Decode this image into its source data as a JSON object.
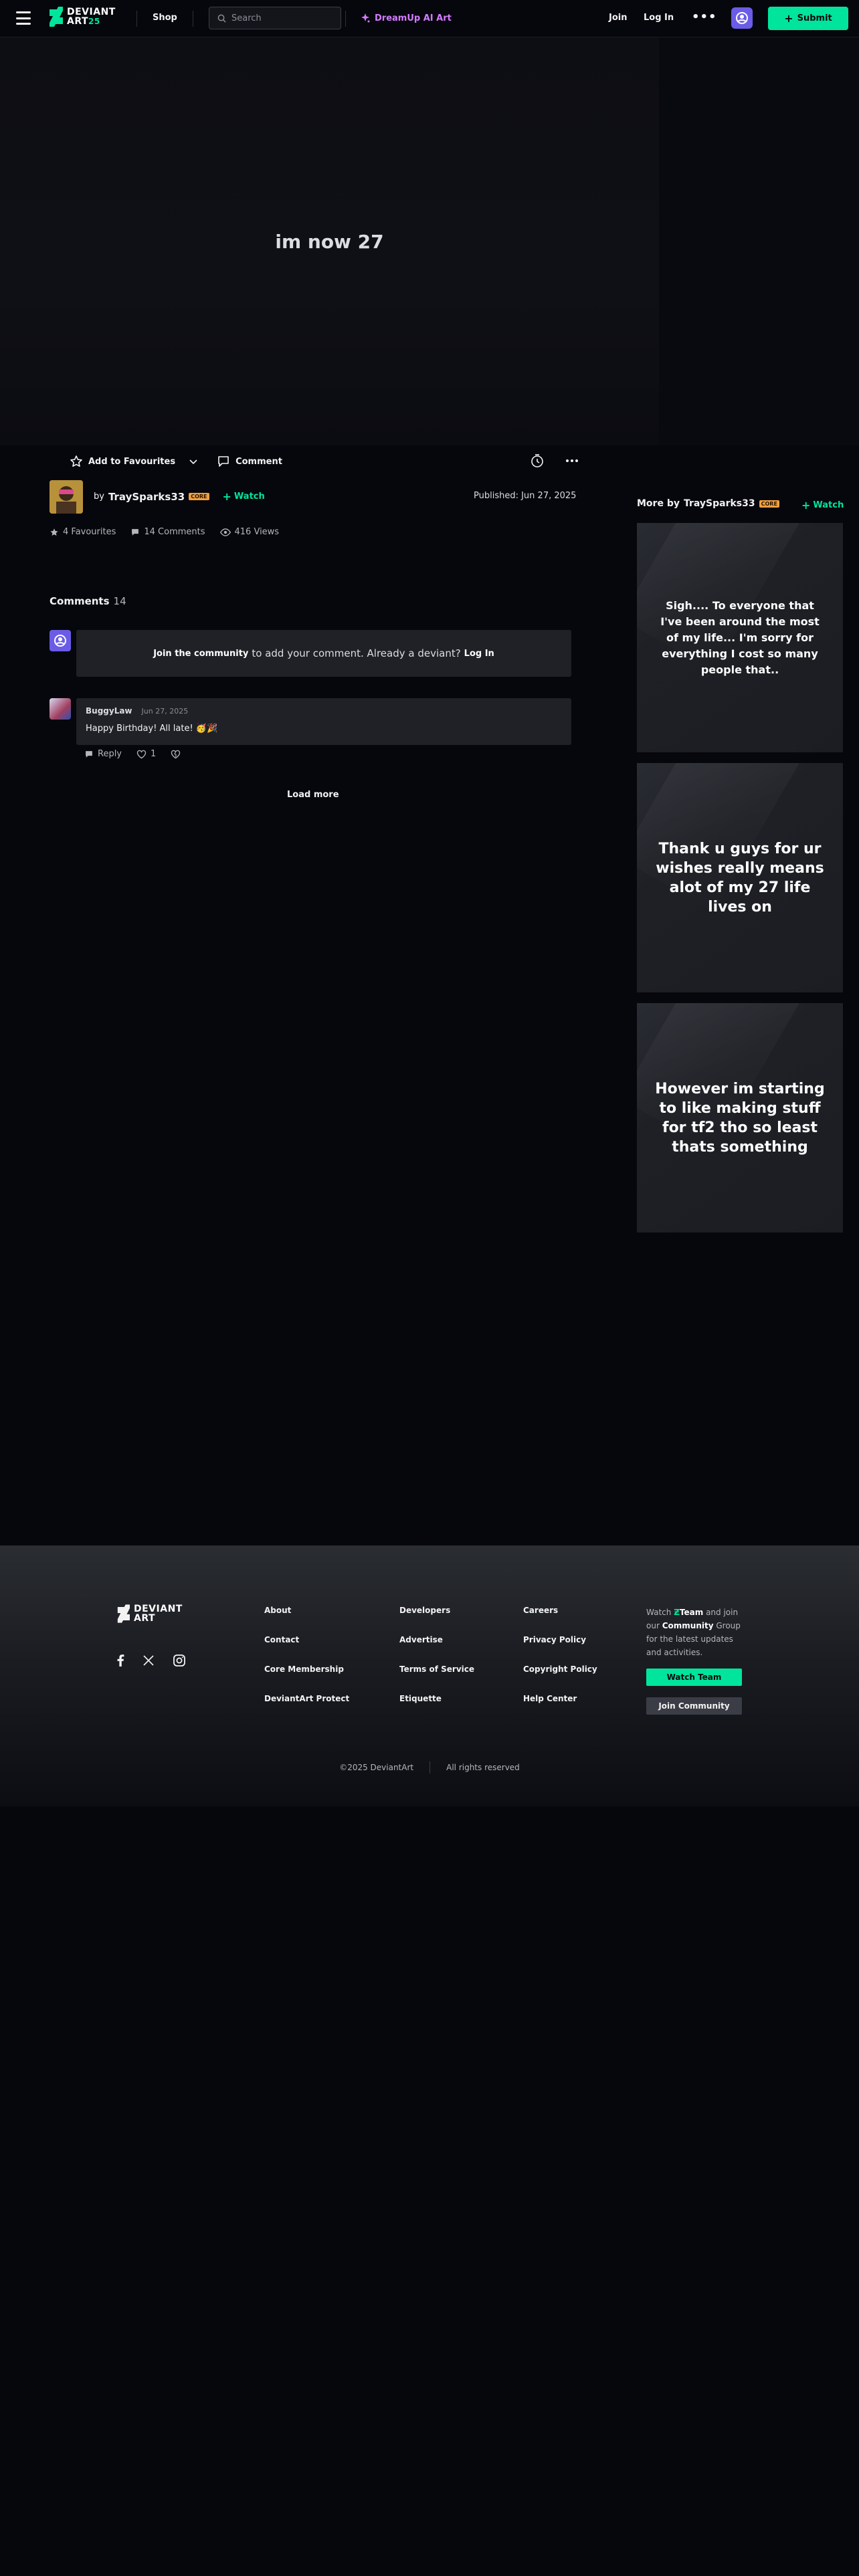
{
  "header": {
    "logo_line1": "DEVIANT",
    "logo_line2": "ART",
    "logo_badge": "25",
    "shop_label": "Shop",
    "search_placeholder": "Search",
    "dreamup_label": "DreamUp AI Art",
    "join_label": "Join",
    "login_label": "Log In",
    "more_label": "•••",
    "submit_label": "Submit"
  },
  "deviation": {
    "title": "im now 27",
    "add_fav_label": "Add to Favourites",
    "comment_label": "Comment",
    "author": "TraySparks33",
    "by_label": "by",
    "core_badge": "CORE",
    "watch_label": "Watch",
    "published": "Published: Jun 27, 2025",
    "favourites": "4 Favourites",
    "comments": "14 Comments",
    "views": "416 Views"
  },
  "comments": {
    "heading": "Comments",
    "count": "14",
    "join_cta": "Join the community",
    "join_text": "to add your comment. Already a deviant?",
    "join_login": "Log In",
    "items": [
      {
        "user": "BuggyLaw",
        "date": "Jun 27, 2025",
        "text": "Happy Birthday! All late! 🥳🎉",
        "reply_label": "Reply",
        "likes": "1"
      }
    ],
    "load_more": "Load more"
  },
  "rail": {
    "heading_prefix": "More by",
    "author": "TraySparks33",
    "core_badge": "CORE",
    "watch_label": "Watch",
    "cards": [
      {
        "text": "Sigh.... To everyone that I've been around the most of my life... I'm sorry for everything I cost so many people that.."
      },
      {
        "text": "Thank u guys for ur wishes really means alot of my 27 life lives on"
      },
      {
        "text": "However im starting to like making stuff for tf2 tho so least thats something"
      }
    ]
  },
  "footer": {
    "col1": [
      "About",
      "Contact",
      "Core Membership",
      "DeviantArt Protect"
    ],
    "col2": [
      "Developers",
      "Advertise",
      "Terms of Service",
      "Etiquette"
    ],
    "col3": [
      "Careers",
      "Privacy Policy",
      "Copyright Policy",
      "Help Center"
    ],
    "team_watch": "Watch",
    "team_name": "Team",
    "team_and": "and join our",
    "team_community": "Community",
    "team_rest": "Group for the latest updates and activities.",
    "watch_team_btn": "Watch Team",
    "join_community_btn": "Join Community",
    "copyright": "©2025 DeviantArt",
    "rights": "All rights reserved"
  },
  "colors": {
    "accent": "#00e59b",
    "dreamup": "#d57bff",
    "background": "#06070d"
  }
}
